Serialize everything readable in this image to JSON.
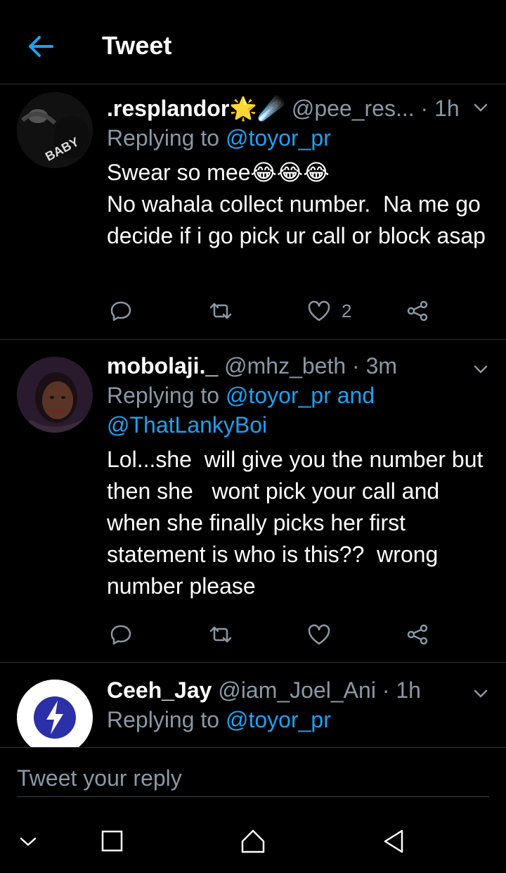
{
  "header": {
    "title": "Tweet"
  },
  "tweets": [
    {
      "name": ".resplandor🌟☄️",
      "handle": "@pee_res...",
      "time": "· 1h",
      "replying_prefix": "Replying to ",
      "replying_to": "@toyor_pr",
      "replying_extra": "",
      "text": "Swear so mee😂😂😂⁣\nNo wahala collect number.  Na me go decide if i go pick ur call or block asap",
      "like_count": "2",
      "avatar_text": "BABY"
    },
    {
      "name": "mobolaji._",
      "handle": "@mhz_beth",
      "time": "· 3m",
      "replying_prefix": "Replying to ",
      "replying_to": "@toyor_pr and",
      "replying_extra": "@ThatLankyBoi",
      "text": "Lol...she  will give you the number but then she   wont pick your call and when she finally picks her first statement is who is this??  wrong number please",
      "like_count": "",
      "avatar_text": ""
    },
    {
      "name": "Ceeh_Jay",
      "handle": "@iam_Joel_Ani",
      "time": "· 1h",
      "replying_prefix": "Replying to ",
      "replying_to": "@toyor_pr",
      "replying_extra": "",
      "text": "",
      "like_count": "",
      "avatar_text": ""
    }
  ],
  "composer": {
    "placeholder": "Tweet your reply"
  },
  "colors": {
    "accent": "#1da1f2",
    "muted": "#8899a6",
    "divider": "#2f3336",
    "background": "#000000"
  },
  "icons": [
    "back-arrow-icon",
    "caret-down-icon",
    "reply-icon",
    "retweet-icon",
    "like-icon",
    "share-icon",
    "nav-collapse-icon",
    "nav-recents-icon",
    "nav-home-icon",
    "nav-back-icon"
  ]
}
